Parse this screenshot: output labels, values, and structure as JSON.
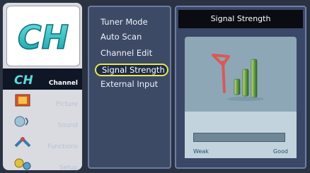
{
  "logo": {
    "text": "CH"
  },
  "left_menu": {
    "channel": {
      "label": "Channel",
      "icon": "ch-icon"
    },
    "picture": {
      "label": "Picture",
      "icon": "picture-icon"
    },
    "sound": {
      "label": "Sound",
      "icon": "sound-icon"
    },
    "functions": {
      "label": "Functions",
      "icon": "functions-icon"
    },
    "setup": {
      "label": "Setup",
      "icon": "setup-icon"
    }
  },
  "middle_menu": {
    "items": [
      {
        "label": "Tuner Mode"
      },
      {
        "label": "Auto Scan"
      },
      {
        "label": "Channel Edit"
      },
      {
        "label": "Signal Strength"
      },
      {
        "label": "External Input"
      }
    ],
    "selected_index": 3
  },
  "signal_panel": {
    "title": "Signal Strength",
    "weak_label": "Weak",
    "good_label": "Good",
    "signal_level": 0.0
  },
  "colors": {
    "accent_selection": "#e8e84c",
    "title_bar": "#0a0c12"
  }
}
